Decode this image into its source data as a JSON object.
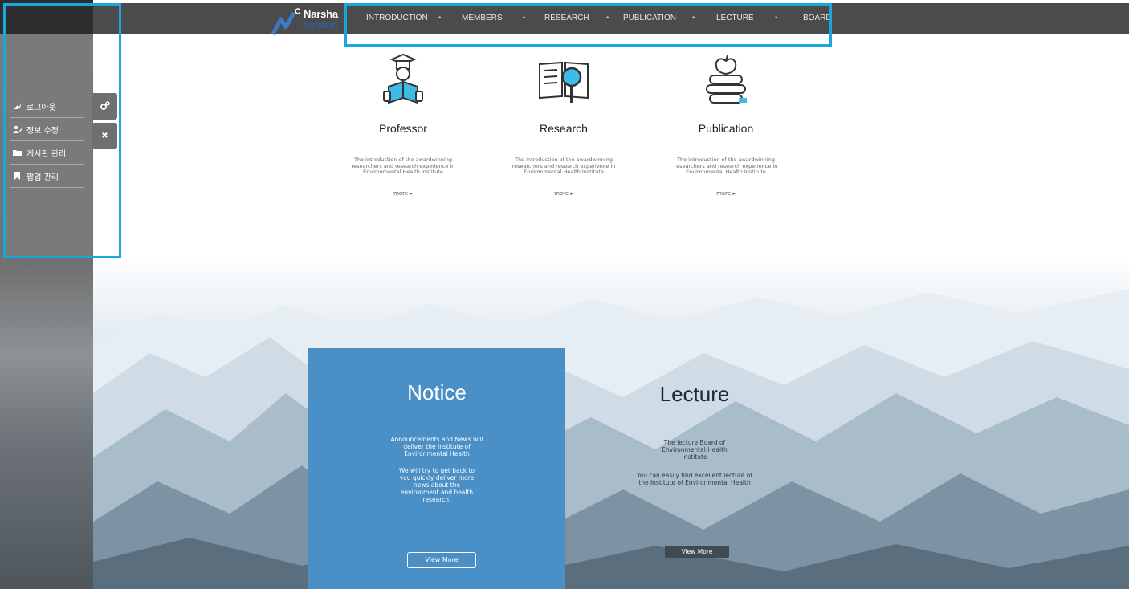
{
  "logo": {
    "line1": "Narsha",
    "line2": "System"
  },
  "nav": {
    "items": [
      "INTRODUCTION",
      "MEMBERS",
      "RESEARCH",
      "PUBLICATION",
      "LECTURE",
      "BOARD"
    ],
    "separator": "•"
  },
  "side_menu": {
    "items": [
      {
        "label": "로그아웃",
        "icon": "logout-icon"
      },
      {
        "label": "정보 수정",
        "icon": "user-edit-icon"
      },
      {
        "label": "게시판 관리",
        "icon": "folder-icon"
      },
      {
        "label": "팝업 관리",
        "icon": "bookmark-icon"
      }
    ],
    "settings_icon": "gears-icon",
    "close_glyph": "✖"
  },
  "features": [
    {
      "title": "Professor",
      "desc": "The introduction of the awardwinning researchers and research experience in Environmental Health Institute",
      "more": "more ▸",
      "icon": "reading-person-icon"
    },
    {
      "title": "Research",
      "desc": "The introduction of the awardwinning researchers and research experience in Environmental Health Institute",
      "more": "more ▸",
      "icon": "magnifier-book-icon"
    },
    {
      "title": "Publication",
      "desc": "The introduction of the awardwinning researchers and research experience in Environmental Health Institute",
      "more": "more ▸",
      "icon": "apple-books-icon"
    }
  ],
  "notice": {
    "title": "Notice",
    "p1": "Announcements and News will deliver the Institute of Environmental Health",
    "p2": "We will try to get back to you quickly deliver more news about the environment and health research.",
    "button": "View More"
  },
  "lecture": {
    "title": "Lecture",
    "p1": "The lecture Board of Environmental Health Institute",
    "p2": "You can easily find excellent lecture of the Institute of Environmental Health",
    "button": "View More"
  },
  "colors": {
    "highlight": "#1ba6dd",
    "notice_bg": "#4a8fc6",
    "topbar": "#4b4b4b"
  }
}
